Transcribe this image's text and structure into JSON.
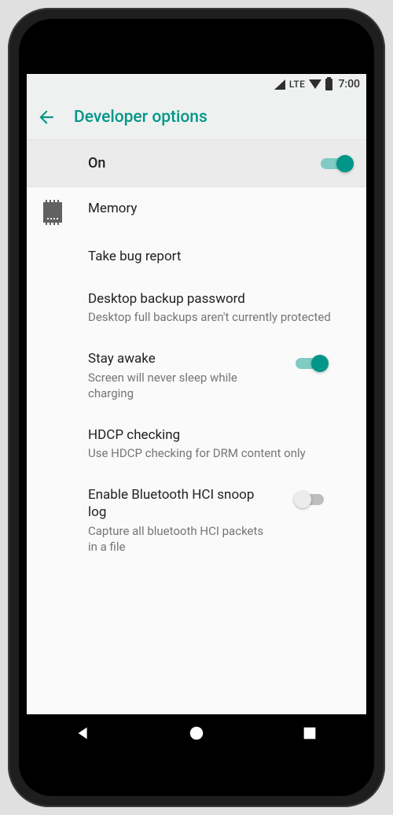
{
  "status": {
    "lte": "LTE",
    "time": "7:00"
  },
  "header": {
    "title": "Developer options"
  },
  "master": {
    "label": "On",
    "state": "on"
  },
  "rows": {
    "memory": {
      "title": "Memory"
    },
    "bugreport": {
      "title": "Take bug report"
    },
    "backup": {
      "title": "Desktop backup password",
      "sub": "Desktop full backups aren't currently protected"
    },
    "stayawake": {
      "title": "Stay awake",
      "sub": "Screen will never sleep while charging",
      "state": "on"
    },
    "hdcp": {
      "title": "HDCP checking",
      "sub": "Use HDCP checking for DRM content only"
    },
    "btsnoop": {
      "title": "Enable Bluetooth HCI snoop log",
      "sub": "Capture all bluetooth HCI packets in a file",
      "state": "off"
    }
  },
  "colors": {
    "accent": "#009688"
  }
}
